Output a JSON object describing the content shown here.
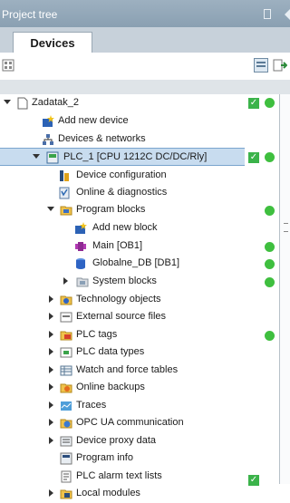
{
  "panel": {
    "title": "Project tree"
  },
  "tabs": [
    {
      "label": "Devices"
    }
  ],
  "tree": {
    "project": "Zadatak_2",
    "items": [
      {
        "key": "add_new_device",
        "label": "Add new device"
      },
      {
        "key": "devices_networks",
        "label": "Devices & networks"
      },
      {
        "key": "plc",
        "label": "PLC_1 [CPU 1212C DC/DC/Rly]"
      },
      {
        "key": "device_configuration",
        "label": "Device configuration"
      },
      {
        "key": "online_diagnostics",
        "label": "Online & diagnostics"
      },
      {
        "key": "program_blocks",
        "label": "Program blocks"
      },
      {
        "key": "add_new_block",
        "label": "Add new block"
      },
      {
        "key": "main",
        "label": "Main [OB1]"
      },
      {
        "key": "globale_db",
        "label": "Globalne_DB [DB1]"
      },
      {
        "key": "system_blocks",
        "label": "System blocks"
      },
      {
        "key": "technology_objects",
        "label": "Technology objects"
      },
      {
        "key": "external_source_files",
        "label": "External source files"
      },
      {
        "key": "plc_tags",
        "label": "PLC tags"
      },
      {
        "key": "plc_data_types",
        "label": "PLC data types"
      },
      {
        "key": "watch_force_tables",
        "label": "Watch and force tables"
      },
      {
        "key": "online_backups",
        "label": "Online backups"
      },
      {
        "key": "traces",
        "label": "Traces"
      },
      {
        "key": "opc_ua",
        "label": "OPC UA communication"
      },
      {
        "key": "device_proxy_data",
        "label": "Device proxy data"
      },
      {
        "key": "program_info",
        "label": "Program info"
      },
      {
        "key": "plc_alarm_text_lists",
        "label": "PLC alarm text lists"
      },
      {
        "key": "local_modules",
        "label": "Local modules"
      }
    ]
  },
  "status_colors": {
    "check": "#3bb34a",
    "online_dot": "#3fbf3f"
  }
}
